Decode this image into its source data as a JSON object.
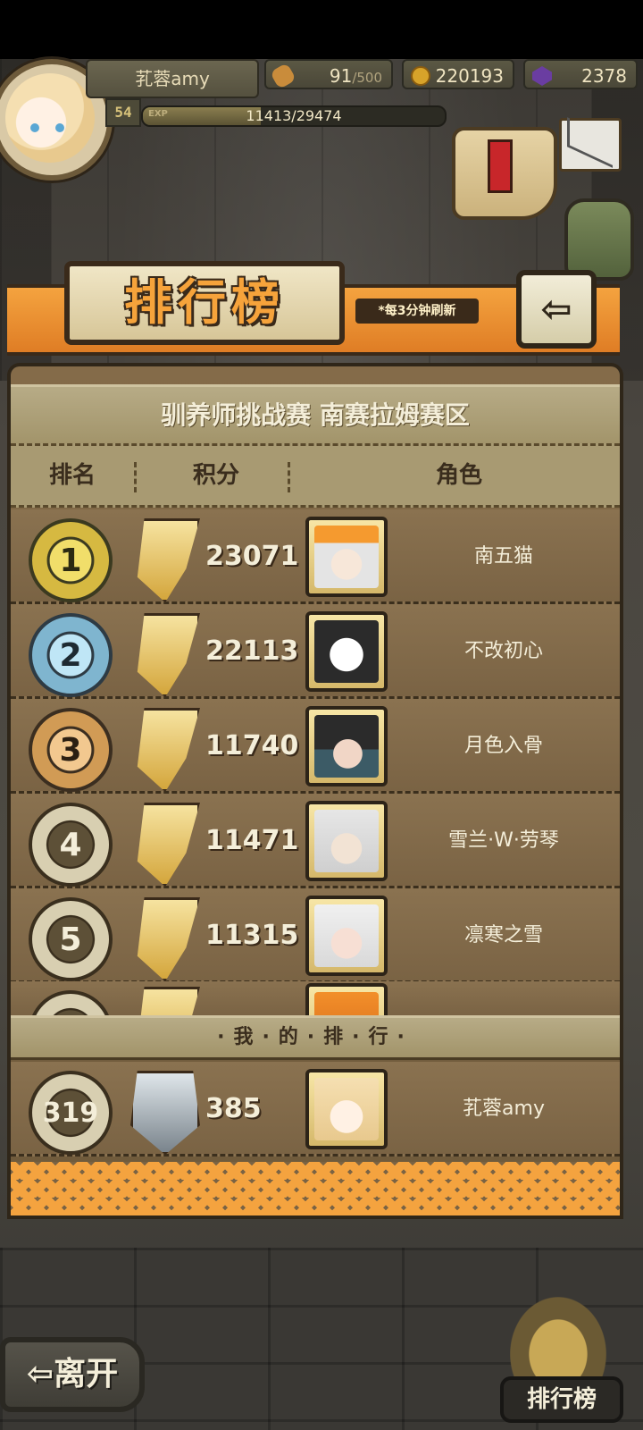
{
  "player": {
    "name": "芤蓉amy",
    "level": "54",
    "exp_tag": "EXP",
    "exp_text": "11413/29474",
    "exp_fraction": 0.387
  },
  "resources": {
    "stamina_current": "91",
    "stamina_max": "/500",
    "gold": "220193",
    "gems": "2378"
  },
  "leaderboard": {
    "title": "排行榜",
    "refresh_note": "*每3分钟刷新",
    "back_icon": "back-arrow-icon",
    "region_title": "驯养师挑战赛 南赛拉姆赛区",
    "headers": {
      "rank": "排名",
      "score": "积分",
      "character": "角色"
    },
    "rows": [
      {
        "rank": "1",
        "score": "23071",
        "name": "南五猫"
      },
      {
        "rank": "2",
        "score": "22113",
        "name": "不改初心"
      },
      {
        "rank": "3",
        "score": "11740",
        "name": "月色入骨"
      },
      {
        "rank": "4",
        "score": "11471",
        "name": "雪兰·W·劳琴"
      },
      {
        "rank": "5",
        "score": "11315",
        "name": "凛寒之雪"
      }
    ],
    "my_rank_label": "·我·的·排·行·",
    "my_row": {
      "rank": "319",
      "score": "385",
      "name": "芤蓉amy"
    }
  },
  "footer": {
    "leave_label": "⇦离开",
    "ranking_button_label": "排行榜"
  }
}
